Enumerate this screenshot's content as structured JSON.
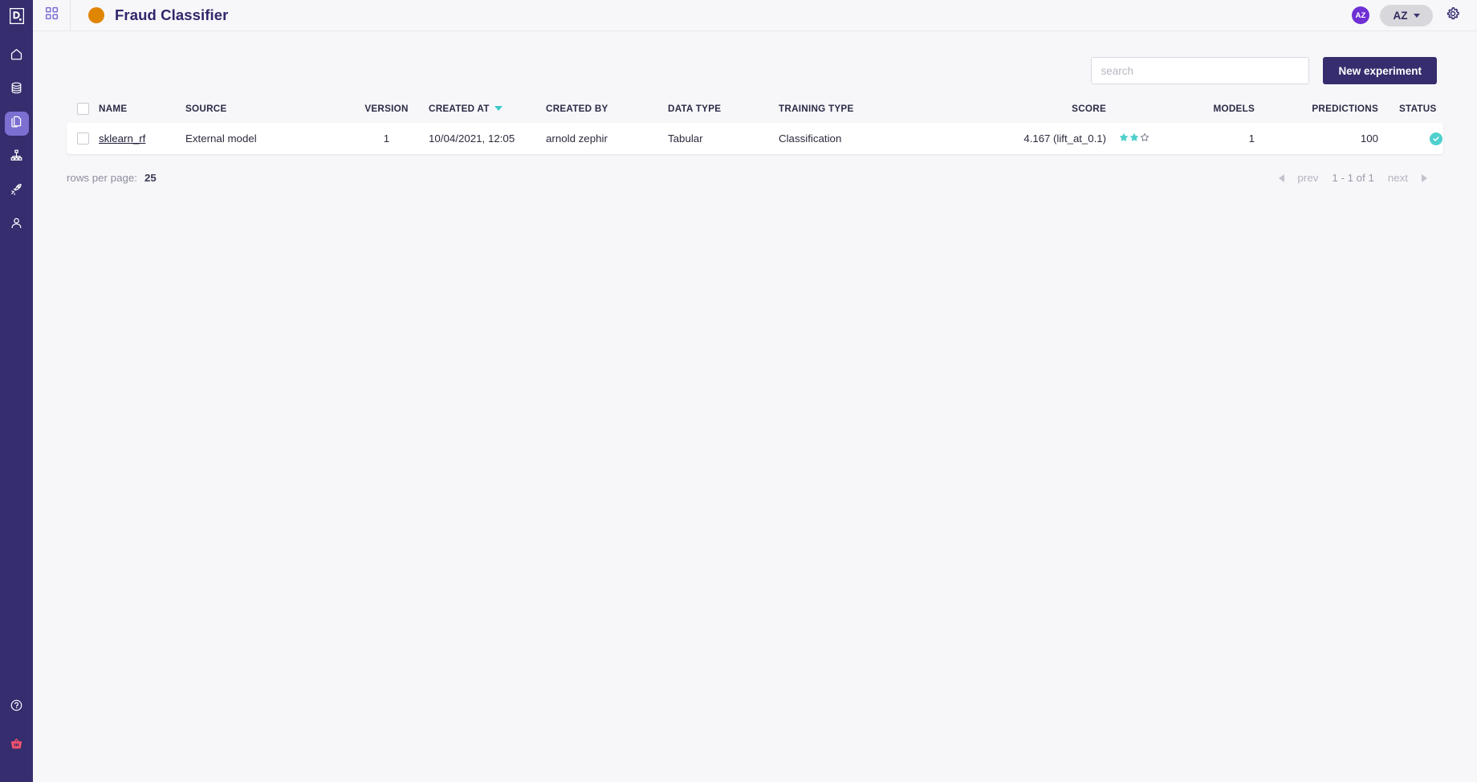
{
  "brand": {
    "logo_icon": "dataiku-logo-icon",
    "sidebar_bg": "#352d6e",
    "accent_purple": "#352d6e",
    "accent_teal": "#3bc8c8",
    "project_dot_color": "#e08500"
  },
  "sidebar": {
    "items": [
      {
        "icon": "home-icon",
        "name": "sidebar-item-home",
        "active": false
      },
      {
        "icon": "database-icon",
        "name": "sidebar-item-datasets",
        "active": false
      },
      {
        "icon": "documents-icon",
        "name": "sidebar-item-experiments",
        "active": true
      },
      {
        "icon": "sitemap-icon",
        "name": "sidebar-item-pipelines",
        "active": false
      },
      {
        "icon": "rocket-icon",
        "name": "sidebar-item-deployments",
        "active": false
      },
      {
        "icon": "user-icon",
        "name": "sidebar-item-account",
        "active": false
      }
    ],
    "bottom_items": [
      {
        "icon": "help-circle-icon",
        "name": "sidebar-item-help"
      },
      {
        "icon": "basket-icon",
        "name": "sidebar-item-marketplace",
        "color": "#f2526b"
      }
    ]
  },
  "topbar": {
    "grid_icon": "grid-apps-icon",
    "project_title": "Fraud Classifier",
    "avatar_initials": "AZ",
    "user_menu_label": "AZ",
    "gear_icon": "gear-icon"
  },
  "toolbar": {
    "search_placeholder": "search",
    "search_value": "",
    "new_experiment_label": "New experiment"
  },
  "table": {
    "columns": [
      {
        "key": "name",
        "label": "NAME"
      },
      {
        "key": "source",
        "label": "SOURCE"
      },
      {
        "key": "version",
        "label": "VERSION"
      },
      {
        "key": "created_at",
        "label": "CREATED AT",
        "sorted": true,
        "sort_dir": "desc"
      },
      {
        "key": "created_by",
        "label": "CREATED BY"
      },
      {
        "key": "data_type",
        "label": "DATA TYPE"
      },
      {
        "key": "training_type",
        "label": "TRAINING TYPE"
      },
      {
        "key": "score",
        "label": "SCORE"
      },
      {
        "key": "models",
        "label": "MODELS"
      },
      {
        "key": "predictions",
        "label": "PREDICTIONS"
      },
      {
        "key": "status",
        "label": "STATUS"
      }
    ],
    "rows": [
      {
        "selected": false,
        "name": "sklearn_rf",
        "source": "External model",
        "version": "1",
        "created_at": "10/04/2021, 12:05",
        "created_by": "arnold zephir",
        "data_type": "Tabular",
        "training_type": "Classification",
        "score": "4.167 (lift_at_0.1)",
        "stars_filled": 2,
        "stars_total": 3,
        "models": "1",
        "predictions": "100",
        "status": "success",
        "row_menu_icon": "kebab-menu-icon"
      }
    ]
  },
  "footer": {
    "rows_per_page_label": "rows per page:",
    "rows_per_page_value": "25",
    "prev_label": "prev",
    "page_range_label": "1 - 1 of 1",
    "next_label": "next"
  }
}
